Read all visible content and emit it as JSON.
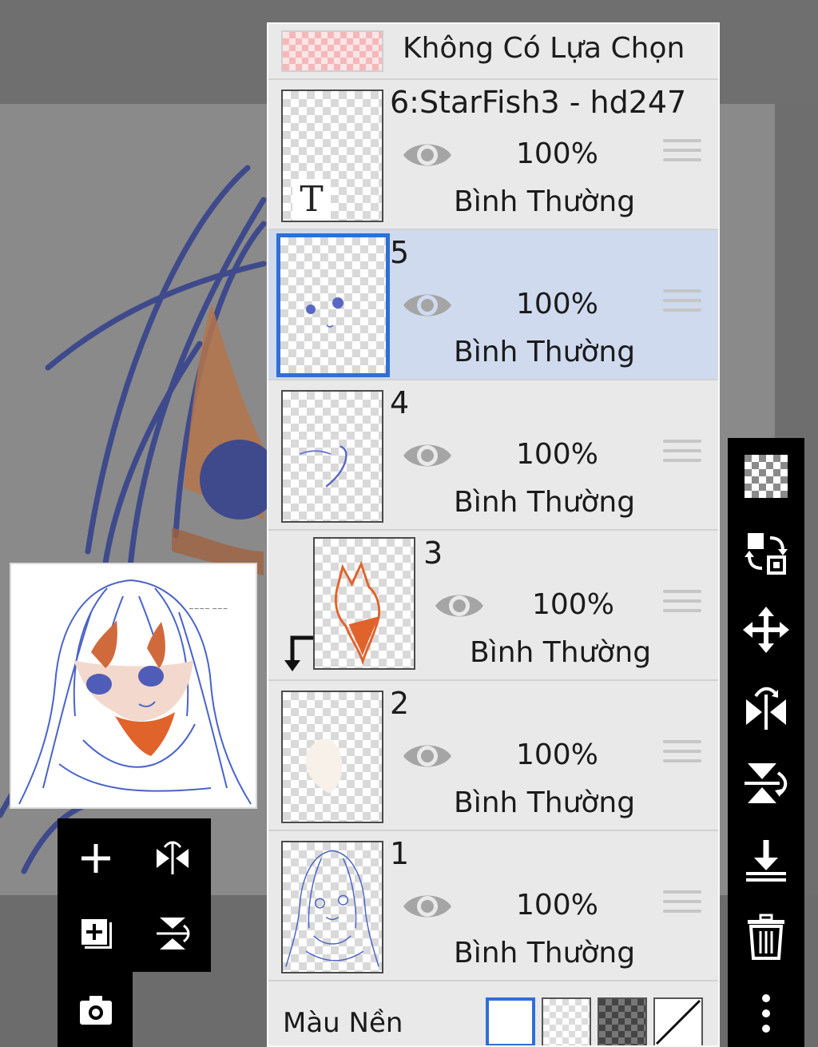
{
  "layer_panel": {
    "selection_label": "Không Có Lựa Chọn",
    "layers": [
      {
        "name": "6:StarFish3 - hd247",
        "opacity": "100%",
        "blend": "Bình Thường",
        "selected": false,
        "clipped": false,
        "is_text": true
      },
      {
        "name": "5",
        "opacity": "100%",
        "blend": "Bình Thường",
        "selected": true,
        "clipped": false,
        "is_text": false
      },
      {
        "name": "4",
        "opacity": "100%",
        "blend": "Bình Thường",
        "selected": false,
        "clipped": false,
        "is_text": false
      },
      {
        "name": "3",
        "opacity": "100%",
        "blend": "Bình Thường",
        "selected": false,
        "clipped": true,
        "is_text": false
      },
      {
        "name": "2",
        "opacity": "100%",
        "blend": "Bình Thường",
        "selected": false,
        "clipped": false,
        "is_text": false
      },
      {
        "name": "1",
        "opacity": "100%",
        "blend": "Bình Thường",
        "selected": false,
        "clipped": false,
        "is_text": false
      }
    ],
    "text_layer_mark": "T",
    "background": {
      "label": "Màu Nền",
      "options": [
        "white",
        "checker",
        "dark-checker",
        "none"
      ],
      "selected": "white"
    }
  },
  "right_toolbar": {
    "icons": [
      "transparency-icon",
      "swap-layer-icon",
      "move-icon",
      "flip-horizontal-icon",
      "flip-vertical-icon",
      "merge-down-icon",
      "trash-icon",
      "more-icon"
    ]
  },
  "left_toolbar": {
    "icons": [
      "add-layer-icon",
      "flip-horizontal-icon",
      "add-special-layer-icon",
      "flip-vertical-icon",
      "camera-icon"
    ]
  },
  "colors": {
    "accent": "#2f6fd6",
    "selected_row": "#cfdaee",
    "panel_bg": "#e9e9e9",
    "toolbar_bg": "#000000",
    "sketch_line": "#3f4a8c",
    "skin_orange": "#e0632c"
  }
}
